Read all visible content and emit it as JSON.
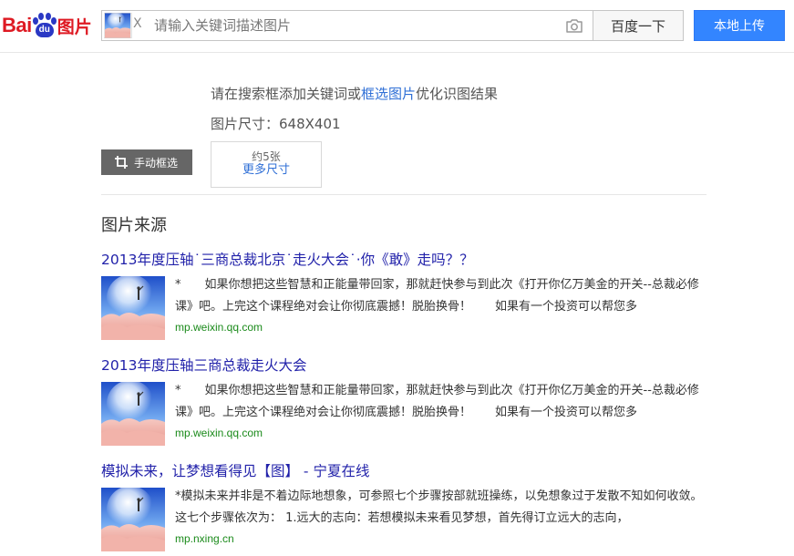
{
  "header": {
    "logo_bai": "Bai",
    "logo_du": "du",
    "logo_tupian": "图片",
    "search_placeholder": "请输入关键词描述图片",
    "thumb_close": "X",
    "search_button": "百度一下",
    "upload_button": "本地上传"
  },
  "info": {
    "hint_prefix": "请在搜索框添加关键词或",
    "hint_link": "框选图片",
    "hint_suffix": "优化识图结果",
    "size_text": "图片尺寸：648X401",
    "crop_button": "手动框选",
    "more_count": "约5张",
    "more_link": "更多尺寸"
  },
  "section_title": "图片来源",
  "results": [
    {
      "title": "2013年度压轴˙三商总裁北京˙走火大会˙·你《敢》走吗？？",
      "desc": "*　　如果你想把这些智慧和正能量带回家，那就赶快参与到此次《打开你亿万美金的开关--总裁必修课》吧。上完这个课程绝对会让你彻底震撼！脱胎换骨！　　如果有一个投资可以帮您多",
      "url": "mp.weixin.qq.com"
    },
    {
      "title": "2013年度压轴三商总裁走火大会",
      "desc": "*　　如果你想把这些智慧和正能量带回家，那就赶快参与到此次《打开你亿万美金的开关--总裁必修课》吧。上完这个课程绝对会让你彻底震撼！脱胎换骨！　　如果有一个投资可以帮您多",
      "url": "mp.weixin.qq.com"
    },
    {
      "title": "模拟未来，让梦想看得见【图】 - 宁夏在线",
      "desc": "*模拟未来并非是不着边际地想象，可参照七个步骤按部就班操练，以免想象过于发散不知如何收敛。这七个步骤依次为： 1.远大的志向：若想模拟未来看见梦想，首先得订立远大的志向，",
      "url": "mp.nxing.cn"
    }
  ],
  "colors": {
    "brand_red": "#de1a23",
    "brand_blue": "#2a38c4",
    "upload_blue": "#3385ff",
    "link_blue": "#2f6fd6",
    "result_title": "#2222aa",
    "url_green": "#1a8a1a"
  }
}
